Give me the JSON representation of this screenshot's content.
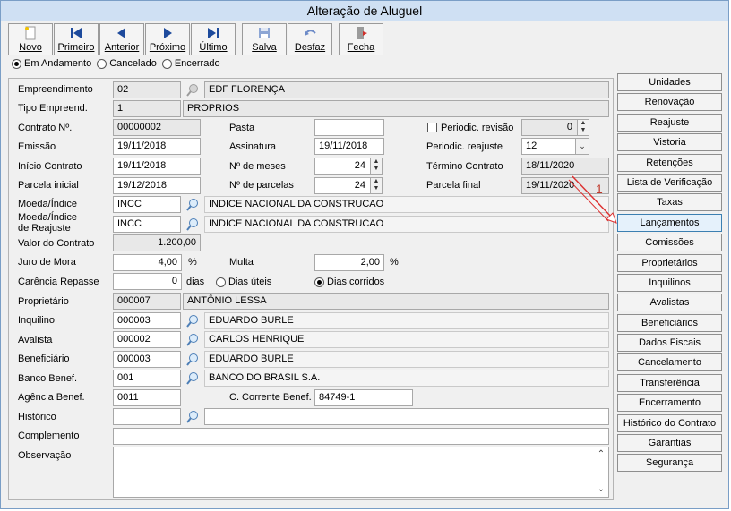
{
  "window": {
    "title": "Alteração de Aluguel"
  },
  "toolbar": [
    {
      "label": "Novo",
      "icon": "new-document-icon"
    },
    {
      "label": "Primeiro",
      "icon": "first-record-icon"
    },
    {
      "label": "Anterior",
      "icon": "previous-record-icon"
    },
    {
      "label": "Próximo",
      "icon": "next-record-icon"
    },
    {
      "label": "Último",
      "icon": "last-record-icon"
    },
    {
      "label": "Salva",
      "icon": "save-icon"
    },
    {
      "label": "Desfaz",
      "icon": "undo-icon"
    },
    {
      "label": "Fecha",
      "icon": "close-door-icon"
    }
  ],
  "status_options": [
    {
      "label": "Em Andamento",
      "selected": true
    },
    {
      "label": "Cancelado",
      "selected": false
    },
    {
      "label": "Encerrado",
      "selected": false
    }
  ],
  "form": {
    "empreendimento": {
      "label": "Empreendimento",
      "code": "02",
      "name": "EDF FLORENÇA"
    },
    "tipo_empreend": {
      "label": "Tipo Empreend.",
      "code": "1",
      "name": "PROPRIOS"
    },
    "contrato": {
      "label": "Contrato Nº.",
      "value": "00000002"
    },
    "pasta": {
      "label": "Pasta",
      "value": ""
    },
    "periodic_revisao": {
      "label": "Periodic. revisão",
      "value": "0",
      "checked": false
    },
    "emissao": {
      "label": "Emissão",
      "value": "19/11/2018"
    },
    "assinatura": {
      "label": "Assinatura",
      "value": "19/11/2018"
    },
    "periodic_reajuste": {
      "label": "Periodic. reajuste",
      "value": "12"
    },
    "inicio_contrato": {
      "label": "Início Contrato",
      "value": "19/11/2018"
    },
    "num_meses": {
      "label": "Nº de meses",
      "value": "24"
    },
    "termino_contrato": {
      "label": "Término Contrato",
      "value": "18/11/2020"
    },
    "parcela_inicial": {
      "label": "Parcela inicial",
      "value": "19/12/2018"
    },
    "num_parcelas": {
      "label": "Nº de parcelas",
      "value": "24"
    },
    "parcela_final": {
      "label": "Parcela final",
      "value": "19/11/2020"
    },
    "moeda_indice": {
      "label": "Moeda/Índice",
      "code": "INCC",
      "name": "INDICE NACIONAL DA CONSTRUCAO"
    },
    "moeda_reajuste": {
      "label1": "Moeda/Índice",
      "label2": "de Reajuste",
      "code": "INCC",
      "name": "INDICE NACIONAL DA CONSTRUCAO"
    },
    "valor_contrato": {
      "label": "Valor do Contrato",
      "value": "1.200,00"
    },
    "juro_mora": {
      "label": "Juro de Mora",
      "value": "4,00",
      "unit": "%"
    },
    "multa": {
      "label": "Multa",
      "value": "2,00",
      "unit": "%"
    },
    "carencia": {
      "label": "Carência Repasse",
      "value": "0",
      "unit": "dias",
      "opt_uteis": "Dias úteis",
      "opt_corridos": "Dias corridos"
    },
    "proprietario": {
      "label": "Proprietário",
      "code": "000007",
      "name": "ANTÔNIO LESSA"
    },
    "inquilino": {
      "label": "Inquilino",
      "code": "000003",
      "name": "EDUARDO BURLE"
    },
    "avalista": {
      "label": "Avalista",
      "code": "000002",
      "name": "CARLOS HENRIQUE"
    },
    "beneficiario": {
      "label": "Beneficiário",
      "code": "000003",
      "name": "EDUARDO BURLE"
    },
    "banco_benef": {
      "label": "Banco Benef.",
      "code": "001",
      "name": "BANCO DO BRASIL S.A."
    },
    "agencia_benef": {
      "label": "Agência Benef.",
      "value": "0011"
    },
    "c_corrente": {
      "label": "C. Corrente Benef.",
      "value": "84749-1"
    },
    "historico": {
      "label": "Histórico",
      "code": "",
      "name": ""
    },
    "complemento": {
      "label": "Complemento",
      "value": ""
    },
    "observacao": {
      "label": "Observação",
      "value": ""
    }
  },
  "side_buttons": [
    "Unidades",
    "Renovação",
    "Reajuste",
    "Vistoria",
    "Retenções",
    "Lista de Verificação",
    "Taxas",
    "Lançamentos",
    "Comissões",
    "Proprietários",
    "Inquilinos",
    "Avalistas",
    "Beneficiários",
    "Dados Fiscais",
    "Cancelamento",
    "Transferência",
    "Encerramento",
    "Histórico do Contrato",
    "Garantias",
    "Segurança"
  ],
  "annotation": {
    "number": "1"
  }
}
